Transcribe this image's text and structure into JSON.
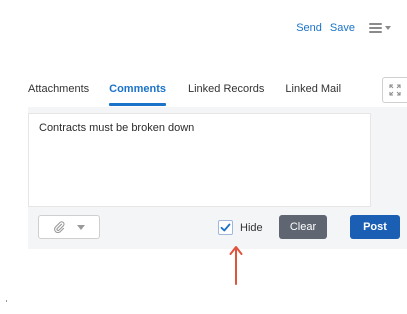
{
  "header": {
    "send_label": "Send",
    "save_label": "Save",
    "menu_icon": "hamburger-menu-icon"
  },
  "tabs": [
    {
      "label": "Attachments",
      "active": false
    },
    {
      "label": "Comments",
      "active": true
    },
    {
      "label": "Linked Records",
      "active": false
    },
    {
      "label": "Linked Mail",
      "active": false
    }
  ],
  "expand_icon": "expand-icon",
  "editor": {
    "value": "Contracts must be broken down"
  },
  "toolbar": {
    "attach_icon": "paperclip-icon",
    "hide_label": "Hide",
    "hide_checked": true,
    "clear_label": "Clear",
    "post_label": "Post"
  },
  "annotation": {
    "arrow_icon": "red-arrow-up-icon",
    "arrow_color": "#e0533f"
  },
  "colors": {
    "accent": "#1a73c8",
    "post": "#1a5fb4",
    "clear": "#5f6672"
  }
}
